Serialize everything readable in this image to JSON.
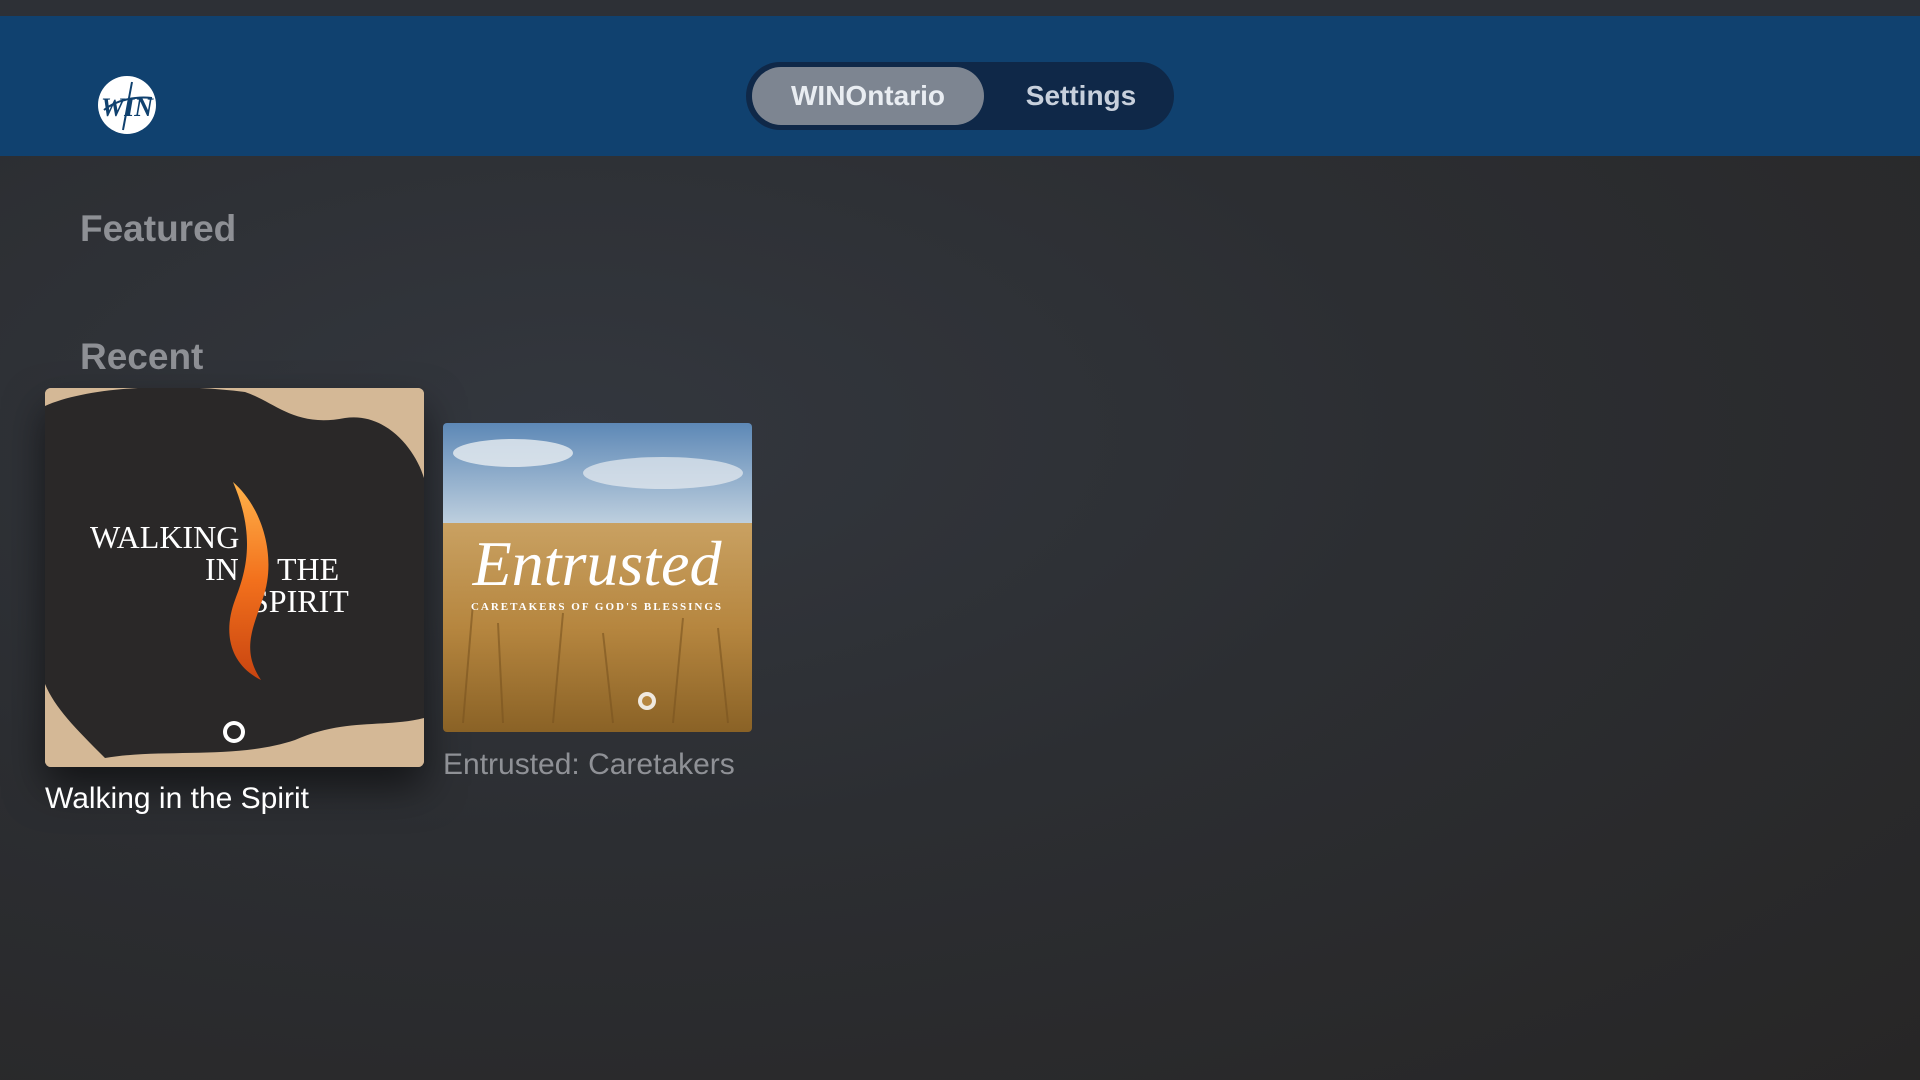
{
  "header": {
    "logo_icon": "win-logo-icon",
    "tabs": [
      {
        "label": "WINOntario",
        "selected": true
      },
      {
        "label": "Settings",
        "selected": false
      }
    ]
  },
  "sections": {
    "featured_title": "Featured",
    "recent_title": "Recent"
  },
  "recent_items": [
    {
      "title": "Walking in the Spirit",
      "artwork_text": [
        "WALKING",
        "IN",
        "THE",
        "SPIRIT"
      ],
      "focused": true
    },
    {
      "title": "Entrusted: Caretakers",
      "artwork_title": "Entrusted",
      "artwork_subtitle": "CARETAKERS OF GOD'S BLESSINGS",
      "focused": false
    }
  ],
  "colors": {
    "header_bg": "#10416f",
    "tab_container": "#0f2848",
    "tab_selected": "#7d8591"
  }
}
